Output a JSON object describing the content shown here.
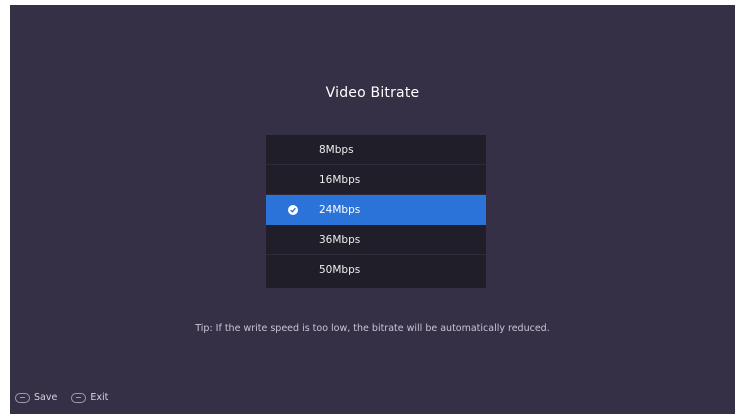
{
  "dialog": {
    "title": "Video Bitrate"
  },
  "options": [
    {
      "label": "8Mbps",
      "selected": false
    },
    {
      "label": "16Mbps",
      "selected": false
    },
    {
      "label": "24Mbps",
      "selected": true
    },
    {
      "label": "36Mbps",
      "selected": false
    },
    {
      "label": "50Mbps",
      "selected": false
    }
  ],
  "tip": "Tip: If the write speed is too low, the bitrate will be automatically reduced.",
  "footer": {
    "save_label": "Save",
    "save_key_icon": "ok-key-icon",
    "exit_label": "Exit",
    "exit_key_icon": "back-key-icon"
  },
  "colors": {
    "background": "#353046",
    "list_background": "#201e29",
    "selected": "#2c73d9"
  }
}
